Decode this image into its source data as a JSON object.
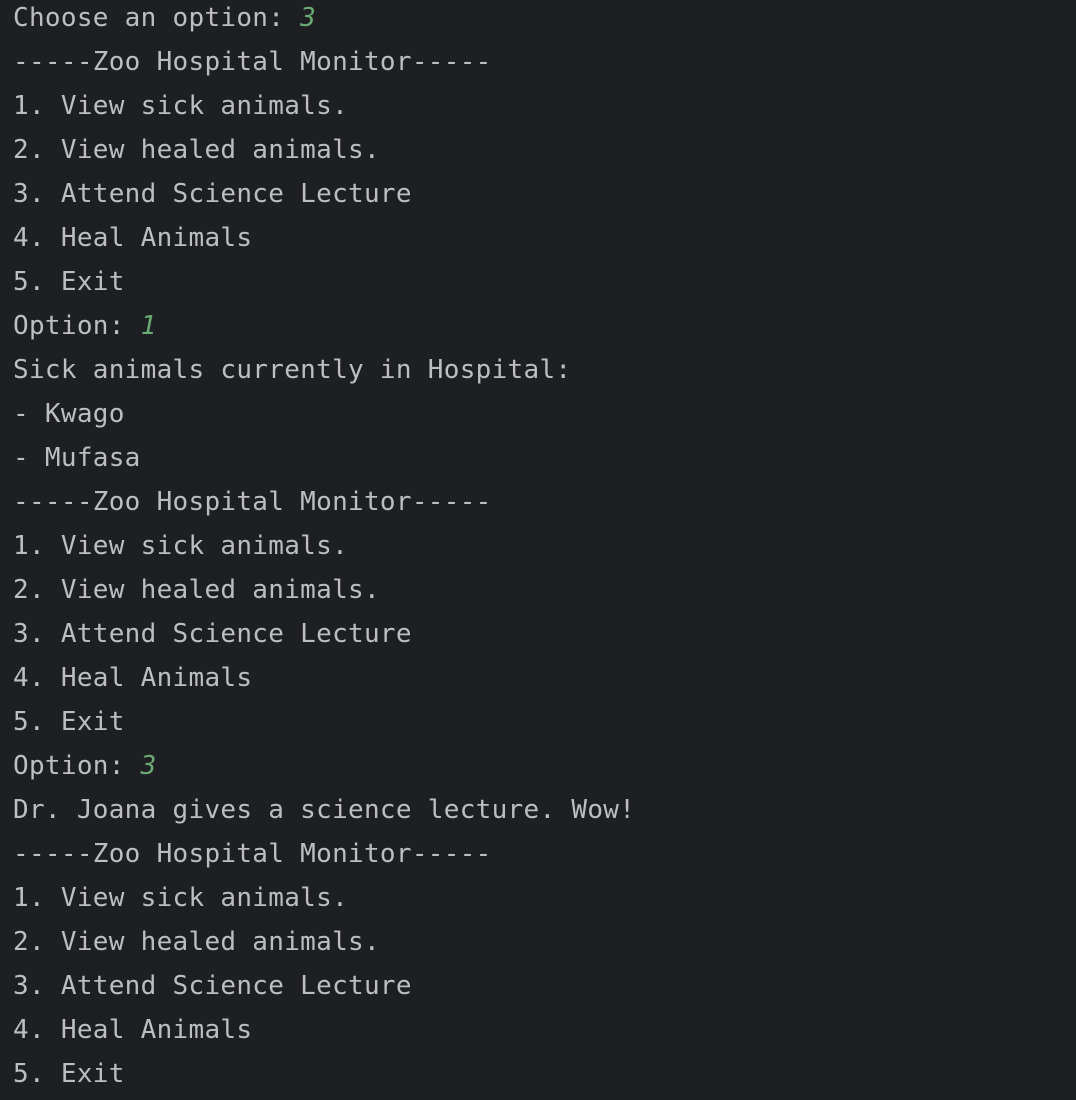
{
  "console": {
    "lines": [
      {
        "text": "Choose an option: ",
        "input": "3"
      },
      {
        "text": "-----Zoo Hospital Monitor-----"
      },
      {
        "text": "1. View sick animals."
      },
      {
        "text": "2. View healed animals."
      },
      {
        "text": "3. Attend Science Lecture"
      },
      {
        "text": "4. Heal Animals"
      },
      {
        "text": "5. Exit"
      },
      {
        "text": "Option: ",
        "input": "1"
      },
      {
        "text": "Sick animals currently in Hospital:"
      },
      {
        "text": "- Kwago"
      },
      {
        "text": "- Mufasa"
      },
      {
        "text": "-----Zoo Hospital Monitor-----"
      },
      {
        "text": "1. View sick animals."
      },
      {
        "text": "2. View healed animals."
      },
      {
        "text": "3. Attend Science Lecture"
      },
      {
        "text": "4. Heal Animals"
      },
      {
        "text": "5. Exit"
      },
      {
        "text": "Option: ",
        "input": "3"
      },
      {
        "text": "Dr. Joana gives a science lecture. Wow!"
      },
      {
        "text": "-----Zoo Hospital Monitor-----"
      },
      {
        "text": "1. View sick animals."
      },
      {
        "text": "2. View healed animals."
      },
      {
        "text": "3. Attend Science Lecture"
      },
      {
        "text": "4. Heal Animals"
      },
      {
        "text": "5. Exit"
      }
    ]
  },
  "colors": {
    "background": "#1e1f22",
    "text": "#bcbec4",
    "user_input": "#6aab73"
  }
}
